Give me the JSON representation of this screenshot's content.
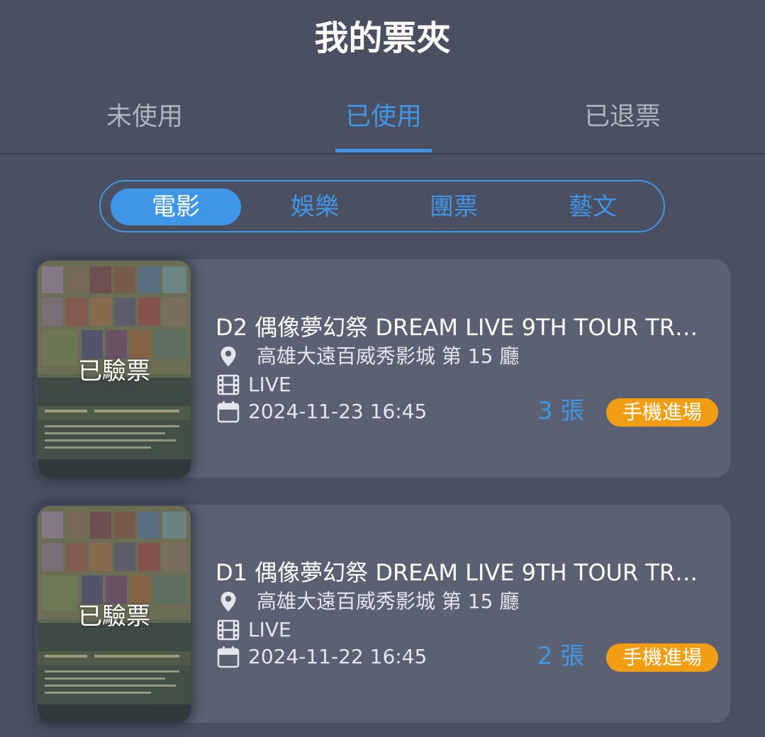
{
  "header": {
    "title": "我的票夾"
  },
  "tabs": [
    {
      "label": "未使用"
    },
    {
      "label": "已使用"
    },
    {
      "label": "已退票"
    }
  ],
  "active_tab": "已使用",
  "categories": [
    {
      "label": "電影"
    },
    {
      "label": "娛樂"
    },
    {
      "label": "團票"
    },
    {
      "label": "藝文"
    }
  ],
  "active_category": "電影",
  "colors": {
    "background": "#4a4f61",
    "card": "#5b6072",
    "accent": "#3f95e6",
    "badge": "#f29e14",
    "inactive_tab": "#aeb2bd"
  },
  "tickets": [
    {
      "status_stamp": "已驗票",
      "title": "D2 偶像夢幻祭 DREAM LIVE 9TH TOUR TR…",
      "location": "高雄大遠百威秀影城 第 15 廳",
      "format": "LIVE",
      "datetime": "2024-11-23 16:45",
      "quantity": "3 張",
      "entry_type": "手機進場",
      "icons": [
        "location-pin-icon",
        "film-icon",
        "calendar-icon"
      ]
    },
    {
      "status_stamp": "已驗票",
      "title": "D1 偶像夢幻祭 DREAM LIVE 9TH TOUR TR…",
      "location": "高雄大遠百威秀影城 第 15 廳",
      "format": "LIVE",
      "datetime": "2024-11-22 16:45",
      "quantity": "2 張",
      "entry_type": "手機進場",
      "icons": [
        "location-pin-icon",
        "film-icon",
        "calendar-icon"
      ]
    }
  ]
}
